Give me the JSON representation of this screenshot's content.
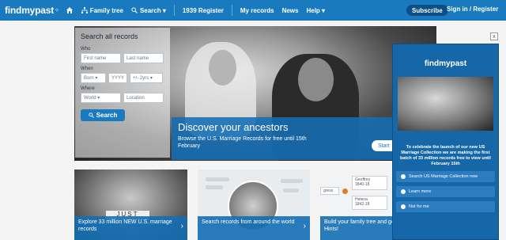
{
  "nav": {
    "logo": "findmypast",
    "items": [
      {
        "label": "Family tree",
        "icon": "family-tree-icon"
      },
      {
        "label": "Search ▾",
        "icon": "search-icon"
      },
      {
        "label": "1939 Register"
      },
      {
        "label": "My records"
      },
      {
        "label": "News"
      },
      {
        "label": "Help ▾"
      }
    ],
    "subscribe": "Subscribe",
    "signin": "Sign in / Register"
  },
  "search": {
    "title": "Search all records",
    "who_label": "Who",
    "first_name_placeholder": "First name",
    "last_name_placeholder": "Last name",
    "when_label": "When",
    "born_value": "Born ▾",
    "year_placeholder": "YYYY",
    "range_value": "+/- 2yrs ▾",
    "where_label": "Where",
    "where_value": "World ▾",
    "location_placeholder": "Location",
    "button": "Search"
  },
  "hero": {
    "heading": "Discover your ancestors",
    "text": "Browse the U.S. Marriage Records for free until 15th February",
    "button": "Start"
  },
  "cards": [
    {
      "caption": "Explore 33 million NEW U.S. marriage records",
      "sign_text": "JUST"
    },
    {
      "caption": "Search records from around the world"
    },
    {
      "caption": "Build your family tree and get Hints!"
    }
  ],
  "tree": {
    "person1": "Geoffrey",
    "person1_years": "1840-18",
    "person2": "Helena",
    "person2_years": "1842-18",
    "progress_label": "gress"
  },
  "popup": {
    "logo": "findmypast",
    "text": "To celebrate the launch of our new US Marriage Collection we are making the first batch of 33 million records free to view until February 15th",
    "options": [
      "Search US Marriage Collection now",
      "Learn more",
      "Not for me"
    ],
    "close": "x"
  },
  "colors": {
    "brand": "#1a7abf",
    "dark": "#0b4f86"
  }
}
